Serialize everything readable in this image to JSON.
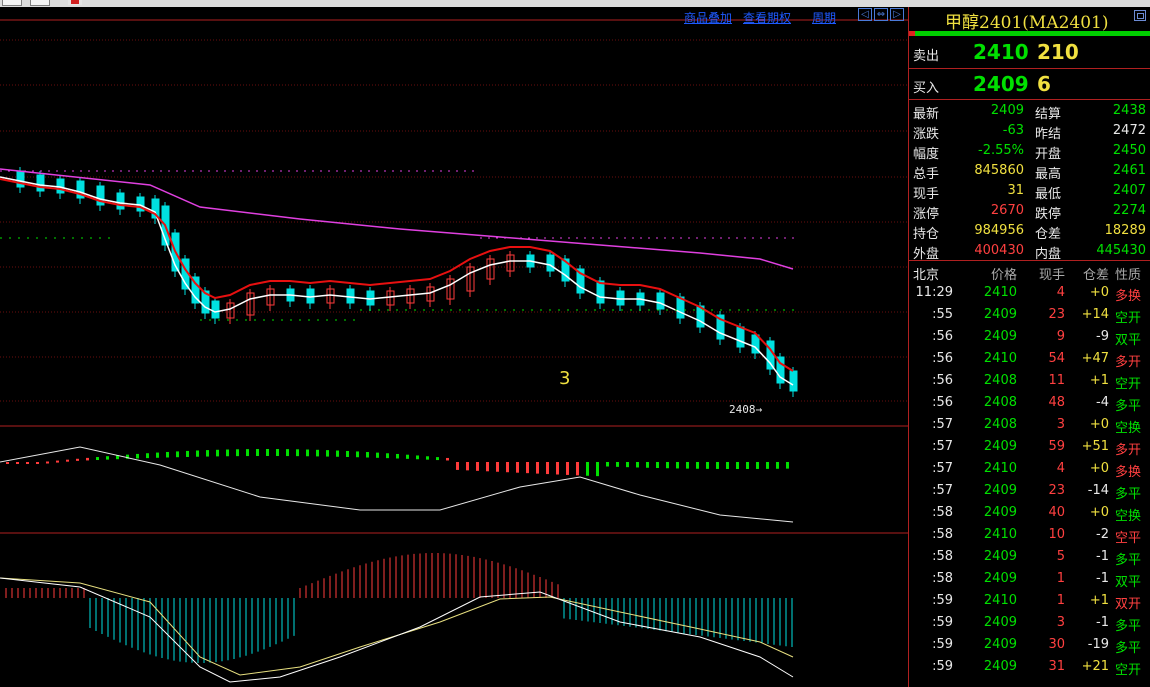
{
  "toolbar": {
    "overlay_label": "商品叠加",
    "options_label": "查看期权",
    "period_label": "周期"
  },
  "chart": {
    "cycle_number": "3",
    "last_price_tag": "2408→"
  },
  "quote": {
    "title": "甲醇2401(MA2401)",
    "ask": {
      "label": "卖出",
      "price": "2410",
      "volume": "210"
    },
    "bid": {
      "label": "买入",
      "price": "2409",
      "volume": "6"
    },
    "stats": [
      {
        "l1": "最新",
        "v1": "2409",
        "c1": "green",
        "l2": "结算",
        "v2": "2438",
        "c2": "green"
      },
      {
        "l1": "涨跌",
        "v1": "-63",
        "c1": "green",
        "l2": "昨结",
        "v2": "2472",
        "c2": "white"
      },
      {
        "l1": "幅度",
        "v1": "-2.55%",
        "c1": "green",
        "l2": "开盘",
        "v2": "2450",
        "c2": "green"
      },
      {
        "l1": "总手",
        "v1": "845860",
        "c1": "yellow",
        "l2": "最高",
        "v2": "2461",
        "c2": "green"
      },
      {
        "l1": "现手",
        "v1": "31",
        "c1": "yellow",
        "l2": "最低",
        "v2": "2407",
        "c2": "green"
      },
      {
        "l1": "涨停",
        "v1": "2670",
        "c1": "red",
        "l2": "跌停",
        "v2": "2274",
        "c2": "green"
      },
      {
        "l1": "持仓",
        "v1": "984956",
        "c1": "yellow",
        "l2": "仓差",
        "v2": "18289",
        "c2": "yellow"
      },
      {
        "l1": "外盘",
        "v1": "400430",
        "c1": "red",
        "l2": "内盘",
        "v2": "445430",
        "c2": "green"
      }
    ],
    "ticks_header": {
      "time": "北京",
      "price": "价格",
      "volume": "现手",
      "oi": "仓差",
      "nature": "性质"
    },
    "ticks": [
      {
        "time": "11:29",
        "price": "2410",
        "pc": "green",
        "vol": "4",
        "oi": "+0",
        "oc": "yellow",
        "nature": "多换",
        "nc": "red"
      },
      {
        "time": ":55",
        "price": "2409",
        "pc": "green",
        "vol": "23",
        "oi": "+14",
        "oc": "yellow",
        "nature": "空开",
        "nc": "green"
      },
      {
        "time": ":56",
        "price": "2409",
        "pc": "green",
        "vol": "9",
        "oi": "-9",
        "oc": "white",
        "nature": "双平",
        "nc": "green"
      },
      {
        "time": ":56",
        "price": "2410",
        "pc": "green",
        "vol": "54",
        "oi": "+47",
        "oc": "yellow",
        "nature": "多开",
        "nc": "red"
      },
      {
        "time": ":56",
        "price": "2408",
        "pc": "green",
        "vol": "11",
        "oi": "+1",
        "oc": "yellow",
        "nature": "空开",
        "nc": "green"
      },
      {
        "time": ":56",
        "price": "2408",
        "pc": "green",
        "vol": "48",
        "oi": "-4",
        "oc": "white",
        "nature": "多平",
        "nc": "green"
      },
      {
        "time": ":57",
        "price": "2408",
        "pc": "green",
        "vol": "3",
        "oi": "+0",
        "oc": "yellow",
        "nature": "空换",
        "nc": "green"
      },
      {
        "time": ":57",
        "price": "2409",
        "pc": "green",
        "vol": "59",
        "oi": "+51",
        "oc": "yellow",
        "nature": "多开",
        "nc": "red"
      },
      {
        "time": ":57",
        "price": "2410",
        "pc": "green",
        "vol": "4",
        "oi": "+0",
        "oc": "yellow",
        "nature": "多换",
        "nc": "red"
      },
      {
        "time": ":57",
        "price": "2409",
        "pc": "green",
        "vol": "23",
        "oi": "-14",
        "oc": "white",
        "nature": "多平",
        "nc": "green"
      },
      {
        "time": ":58",
        "price": "2409",
        "pc": "green",
        "vol": "40",
        "oi": "+0",
        "oc": "yellow",
        "nature": "空换",
        "nc": "green"
      },
      {
        "time": ":58",
        "price": "2410",
        "pc": "green",
        "vol": "10",
        "oi": "-2",
        "oc": "white",
        "nature": "空平",
        "nc": "red"
      },
      {
        "time": ":58",
        "price": "2409",
        "pc": "green",
        "vol": "5",
        "oi": "-1",
        "oc": "white",
        "nature": "多平",
        "nc": "green"
      },
      {
        "time": ":58",
        "price": "2409",
        "pc": "green",
        "vol": "1",
        "oi": "-1",
        "oc": "white",
        "nature": "双平",
        "nc": "green"
      },
      {
        "time": ":59",
        "price": "2410",
        "pc": "green",
        "vol": "1",
        "oi": "+1",
        "oc": "yellow",
        "nature": "双开",
        "nc": "red"
      },
      {
        "time": ":59",
        "price": "2409",
        "pc": "green",
        "vol": "3",
        "oi": "-1",
        "oc": "white",
        "nature": "多平",
        "nc": "green"
      },
      {
        "time": ":59",
        "price": "2409",
        "pc": "green",
        "vol": "30",
        "oi": "-19",
        "oc": "white",
        "nature": "多平",
        "nc": "green"
      },
      {
        "time": ":59",
        "price": "2409",
        "pc": "green",
        "vol": "31",
        "oi": "+21",
        "oc": "yellow",
        "nature": "空开",
        "nc": "green"
      }
    ]
  },
  "colors": {
    "up": "#ff3b3b",
    "down": "#00e0e0",
    "ma_white": "#ffffff",
    "ma_red": "#e81010",
    "ma_magenta": "#e040e0",
    "grid_red": "#6a0e0e",
    "green": "#00e000",
    "yellow": "#f0e040"
  }
}
